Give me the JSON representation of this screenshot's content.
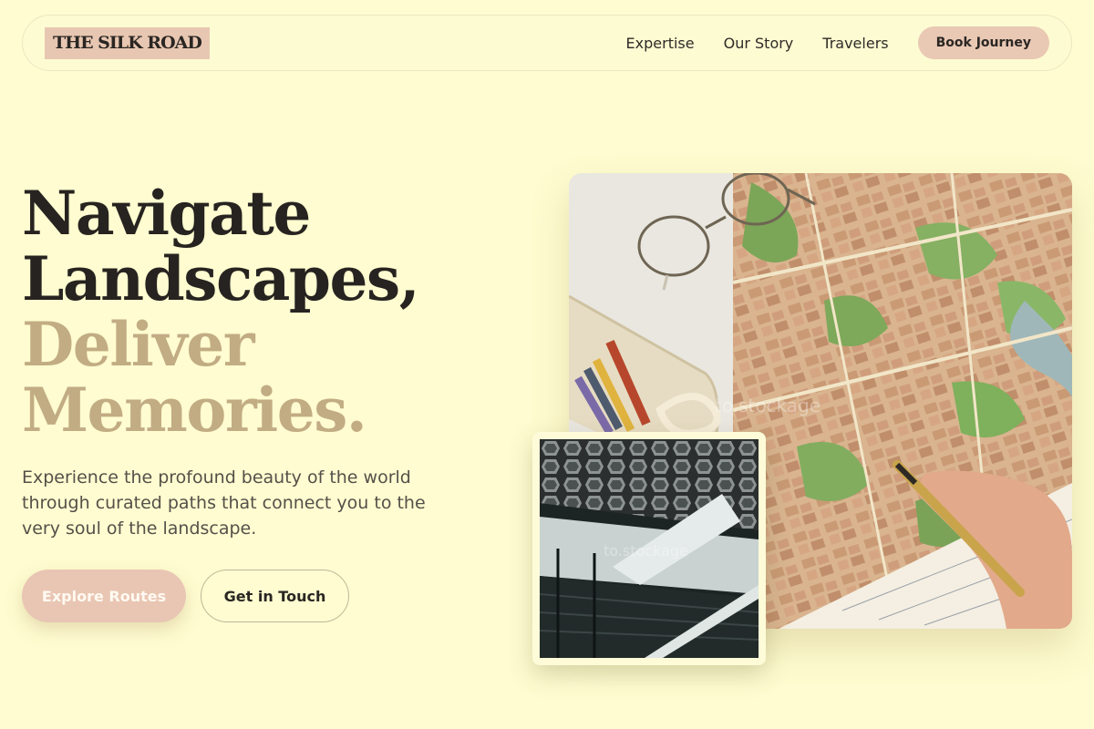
{
  "nav": {
    "logo": "THE SILK ROAD",
    "links": [
      "Expertise",
      "Our Story",
      "Travelers"
    ],
    "cta": "Book Journey"
  },
  "hero": {
    "headline_line1": "Navigate",
    "headline_line2": "Landscapes,",
    "headline_line3": "Deliver",
    "headline_line4": "Memories.",
    "lead": "Experience the profound beauty of the world through curated paths that connect you to the very soul of the landscape.",
    "primary_button": "Explore Routes",
    "secondary_button": "Get in Touch"
  },
  "colors": {
    "background": "#fefcd0",
    "accent_pink": "#e9c6b3",
    "accent_gold": "#c2ac84",
    "text_dark": "#272320"
  },
  "images": {
    "main": "travel-map-photo",
    "inset": "architecture-photo"
  }
}
